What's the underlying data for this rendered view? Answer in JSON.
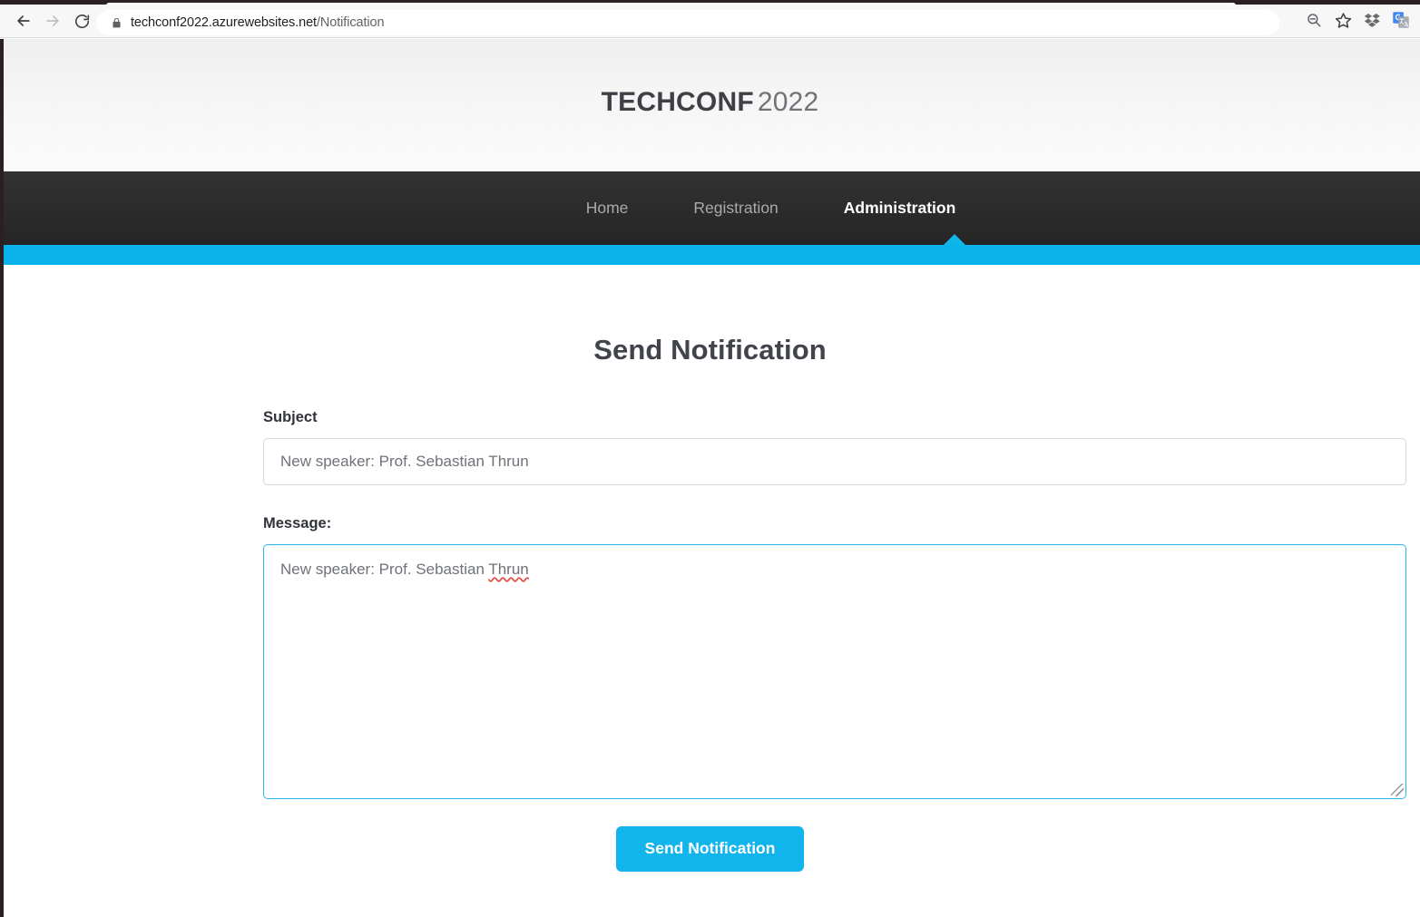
{
  "browser": {
    "url_host": "techconf2022.azurewebsites.net",
    "url_path": "/Notification",
    "back_icon": "back-arrow-icon",
    "forward_icon": "forward-arrow-icon",
    "reload_icon": "reload-icon",
    "lock_icon": "lock-icon",
    "zoom_out_icon": "zoom-out-icon",
    "bookmark_icon": "star-icon",
    "dropbox_icon": "dropbox-extension-icon",
    "translate_icon": "google-translate-icon"
  },
  "site": {
    "brand_bold": "TECHCONF",
    "brand_light": "2022",
    "accent_color": "#0bb3ec",
    "nav_bg": "#2b2b2b"
  },
  "nav": {
    "items": [
      {
        "label": "Home",
        "active": false
      },
      {
        "label": "Registration",
        "active": false
      },
      {
        "label": "Administration",
        "active": true
      }
    ]
  },
  "main": {
    "title": "Send Notification",
    "subject": {
      "label": "Subject",
      "value": "New speaker: Prof. Sebastian Thrun",
      "placeholder": "New speaker: Prof. Sebastian Thrun"
    },
    "message": {
      "label": "Message:",
      "value_prefix": "New speaker: Prof. Sebastian ",
      "value_misspelled": "Thrun"
    },
    "submit_label": "Send Notification",
    "submit_color": "#12b4ec"
  }
}
